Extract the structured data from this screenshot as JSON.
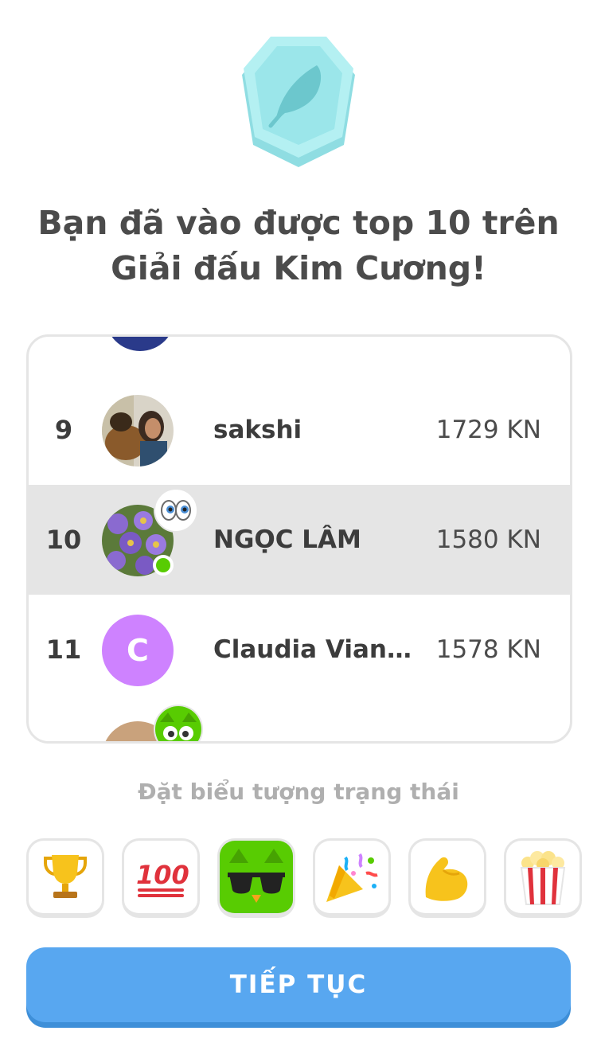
{
  "headline": {
    "line1": "Bạn đã vào được top 10 trên",
    "line2": "Giải đấu Kim Cương!"
  },
  "league_badge": {
    "icon": "feather-icon",
    "color": "#9fe8ec"
  },
  "leaderboard": {
    "rows": [
      {
        "rank": "9",
        "name": "sakshi",
        "xp": "1729 KN",
        "avatar": "photo-dog",
        "highlight": false
      },
      {
        "rank": "10",
        "name": "NGỌC LÂM",
        "xp": "1580 KN",
        "avatar": "photo-flowers",
        "status_icon": "eyes-icon",
        "online": true,
        "highlight": true
      },
      {
        "rank": "11",
        "name": "Claudia Vian...",
        "xp": "1578 KN",
        "avatar_letter": "C",
        "avatar_color": "#ce82ff",
        "highlight": false
      }
    ]
  },
  "status_picker": {
    "label": "Đặt biểu tượng trạng thái",
    "icons": [
      "trophy-icon",
      "hundred-points-icon",
      "cool-owl-icon",
      "party-popper-icon",
      "flexed-biceps-icon",
      "popcorn-icon"
    ],
    "selected": "cool-owl-icon"
  },
  "continue_button": {
    "label": "TIẾP TỤC",
    "color": "#58a7f0"
  }
}
